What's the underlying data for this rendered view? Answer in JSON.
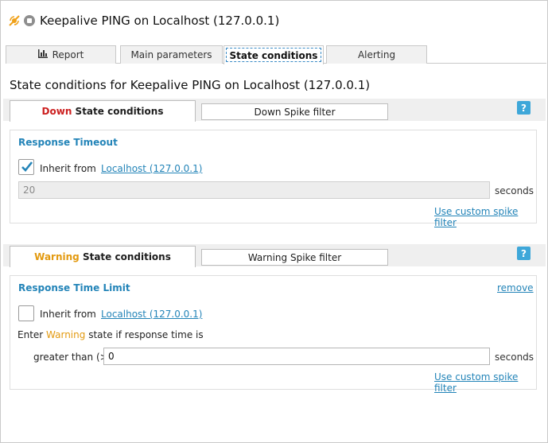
{
  "window": {
    "title": "Keepalive PING on Localhost (127.0.0.1)",
    "icon": "sensor-icon",
    "status_icon": "stop-status-icon"
  },
  "tabs": [
    {
      "label": "Report",
      "icon": "bar-chart-icon",
      "active": false
    },
    {
      "label": "Main parameters",
      "active": false
    },
    {
      "label": "State conditions",
      "active": true
    },
    {
      "label": "Alerting",
      "active": false
    }
  ],
  "heading": "State conditions for Keepalive PING on Localhost (127.0.0.1)",
  "down": {
    "tab_state_word": "Down",
    "tab_suffix": " State conditions",
    "spike_tab": "Down Spike filter",
    "help": "?",
    "panel": {
      "title": "Response Timeout",
      "inherit_checked": true,
      "inherit_label": "Inherit from",
      "inherit_link": "Localhost (127.0.0.1)",
      "value": "20",
      "unit": "seconds",
      "custom_link": "Use custom spike filter"
    }
  },
  "warning": {
    "tab_state_word": "Warning",
    "tab_suffix": " State conditions",
    "spike_tab": "Warning Spike filter",
    "help": "?",
    "panel": {
      "title": "Response Time Limit",
      "remove_link": "remove",
      "inherit_checked": false,
      "inherit_label": "Inherit from",
      "inherit_link": "Localhost (127.0.0.1)",
      "enter_prefix": "Enter ",
      "enter_state": "Warning",
      "enter_suffix": " state if response time is",
      "comparison_label": "greater than (>)",
      "value": "0",
      "unit": "seconds",
      "custom_link": "Use custom spike filter"
    }
  },
  "colors": {
    "accent": "#2384b8",
    "down": "#cc1f1f",
    "warning": "#e39a10",
    "help": "#3ea7d9"
  }
}
